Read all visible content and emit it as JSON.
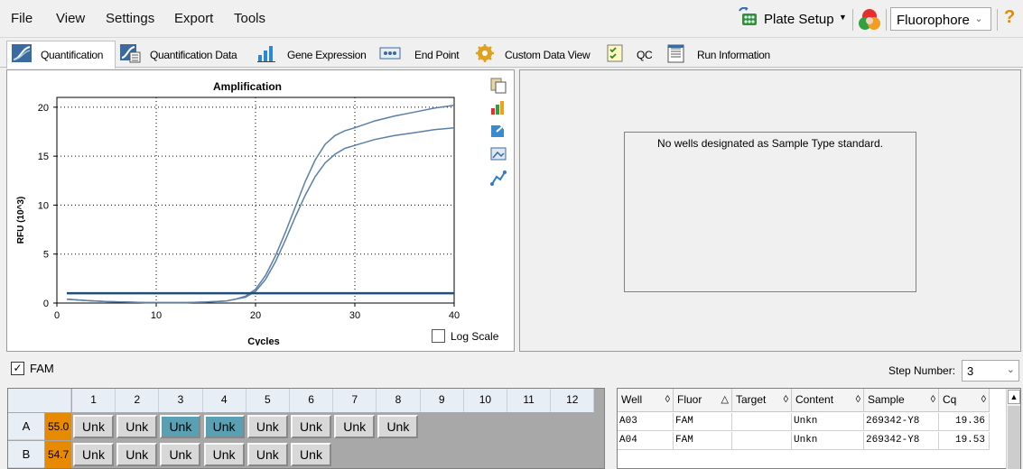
{
  "menu": {
    "items": [
      "File",
      "View",
      "Settings",
      "Export",
      "Tools"
    ]
  },
  "toolbar": {
    "plate_setup_label": "Plate Setup",
    "fluorophore_select": "Fluorophore",
    "help": "?"
  },
  "tabs": [
    {
      "label": "Quantification",
      "active": true
    },
    {
      "label": "Quantification Data"
    },
    {
      "label": "Gene Expression"
    },
    {
      "label": "End Point"
    },
    {
      "label": "Custom Data View"
    },
    {
      "label": "QC"
    },
    {
      "label": "Run Information"
    }
  ],
  "chart_panel": {
    "log_scale_label": "Log Scale",
    "log_scale_checked": false
  },
  "chart_data": {
    "type": "line",
    "title": "Amplification",
    "xlabel": "Cycles",
    "ylabel": "RFU (10^3)",
    "xlim": [
      0,
      40
    ],
    "ylim": [
      0,
      21
    ],
    "xticks": [
      "0",
      "10",
      "20",
      "30",
      "40"
    ],
    "yticks": [
      "0",
      "5",
      "10",
      "15",
      "20"
    ],
    "grid": true,
    "x": [
      1,
      3,
      5,
      7,
      9,
      11,
      13,
      15,
      17,
      18,
      19,
      20,
      21,
      22,
      23,
      24,
      25,
      26,
      27,
      28,
      29,
      30,
      32,
      34,
      36,
      38,
      40
    ],
    "series": [
      {
        "values": [
          0.4,
          0.25,
          0.15,
          0.1,
          0.05,
          0.05,
          0.05,
          0.1,
          0.2,
          0.4,
          0.7,
          1.4,
          2.8,
          4.8,
          7.2,
          9.8,
          12.4,
          14.6,
          16.2,
          17.1,
          17.6,
          17.9,
          18.6,
          19.1,
          19.5,
          19.9,
          20.2
        ]
      },
      {
        "values": [
          0.4,
          0.25,
          0.15,
          0.1,
          0.05,
          0.05,
          0.05,
          0.1,
          0.2,
          0.4,
          0.6,
          1.2,
          2.4,
          4.2,
          6.4,
          8.8,
          11.0,
          12.9,
          14.3,
          15.2,
          15.8,
          16.1,
          16.7,
          17.1,
          17.4,
          17.7,
          17.9
        ]
      }
    ],
    "threshold": 1.0,
    "line_color": "#5a7fa8",
    "threshold_color": "#1f4e79"
  },
  "right_panel": {
    "message": "No wells designated as Sample Type standard."
  },
  "fluor_bar": {
    "checkbox_checked": true,
    "label": "FAM",
    "step_label": "Step Number:",
    "step_value": "3"
  },
  "plate": {
    "columns": [
      "1",
      "2",
      "3",
      "4",
      "5",
      "6",
      "7",
      "8",
      "9",
      "10",
      "11",
      "12"
    ],
    "rows": [
      {
        "label": "A",
        "temp": "55.0",
        "wells": [
          "Unk",
          "Unk",
          "Unk",
          "Unk",
          "Unk",
          "Unk",
          "Unk",
          "Unk"
        ],
        "selected": [
          2,
          3
        ]
      },
      {
        "label": "B",
        "temp": "54.7",
        "wells": [
          "Unk",
          "Unk",
          "Unk",
          "Unk",
          "Unk",
          "Unk"
        ],
        "selected": []
      }
    ],
    "temp_color": "#e88a00",
    "selected_color": "#5aa0b5"
  },
  "well_table": {
    "columns": [
      "Well",
      "Fluor",
      "Target",
      "Content",
      "Sample",
      "Cq"
    ],
    "rows": [
      {
        "Well": "A03",
        "Fluor": "FAM",
        "Target": "",
        "Content": "Unkn",
        "Sample": "269342-Y8",
        "Cq": "19.36"
      },
      {
        "Well": "A04",
        "Fluor": "FAM",
        "Target": "",
        "Content": "Unkn",
        "Sample": "269342-Y8",
        "Cq": "19.53"
      }
    ]
  }
}
